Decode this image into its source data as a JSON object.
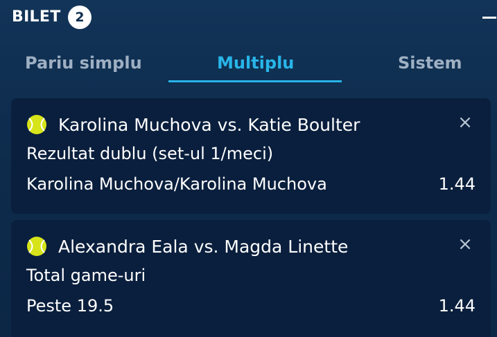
{
  "header": {
    "title": "BILET",
    "count": "2"
  },
  "tabs": [
    {
      "label": "Pariu simplu",
      "active": false
    },
    {
      "label": "Multiplu",
      "active": true
    },
    {
      "label": "Sistem",
      "active": false
    }
  ],
  "colors": {
    "background": "#0f2d4e",
    "card": "#0a1f3d",
    "accent": "#28b5e8",
    "inactive_tab": "#9fb0c3",
    "ball": "#d7e41a"
  },
  "bets": [
    {
      "sport_icon": "tennis-ball-icon",
      "match": "Karolina Muchova vs. Katie Boulter",
      "market": "Rezultat dublu (set-ul 1/meci)",
      "selection": "Karolina Muchova/Karolina Muchova",
      "odds": "1.44"
    },
    {
      "sport_icon": "tennis-ball-icon",
      "match": "Alexandra Eala vs. Magda Linette",
      "market": "Total game-uri",
      "selection": "Peste 19.5",
      "odds": "1.44"
    }
  ]
}
